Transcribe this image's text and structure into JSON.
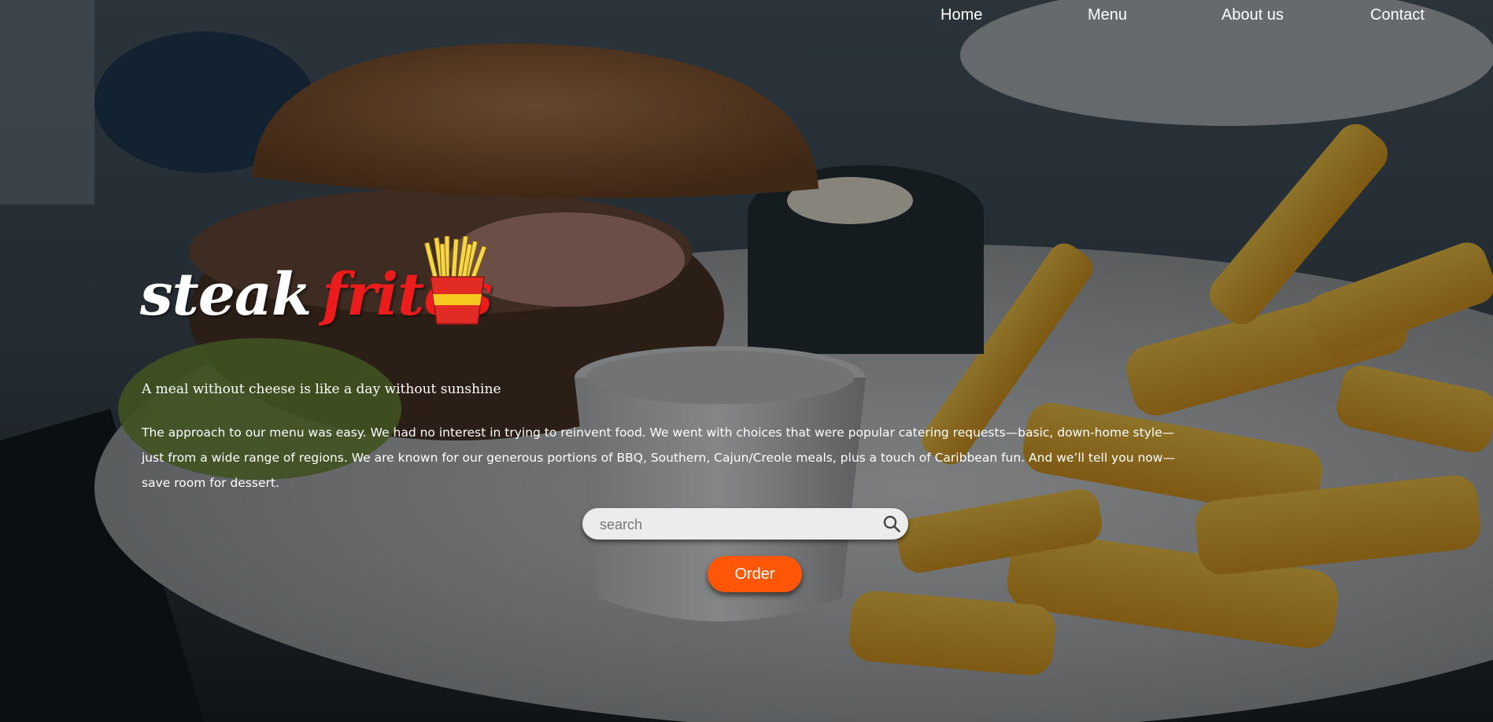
{
  "nav": {
    "items": [
      {
        "label": "Home"
      },
      {
        "label": "Menu"
      },
      {
        "label": "About us"
      },
      {
        "label": "Contact"
      }
    ]
  },
  "hero": {
    "brand_part1": "steak",
    "brand_part2": "frites",
    "tagline": "A meal without cheese is like a day without sunshine",
    "description": "The approach to our menu was easy. We had no interest in trying to reinvent food. We went with choices that were popular catering requests—basic, down-home style—just from a wide range of regions. We are known for our generous portions of BBQ, Southern, Cajun/Creole meals, plus a touch of Caribbean fun. And we’ll tell you now—save room for dessert."
  },
  "search": {
    "placeholder": "search",
    "value": ""
  },
  "order": {
    "label": "Order"
  },
  "colors": {
    "accent": "#ff5607",
    "brand_red": "#ec1c1c",
    "overlay": "rgba(0,0,0,0.42)"
  },
  "icons": {
    "brand": "fries-icon",
    "search": "search-icon"
  }
}
